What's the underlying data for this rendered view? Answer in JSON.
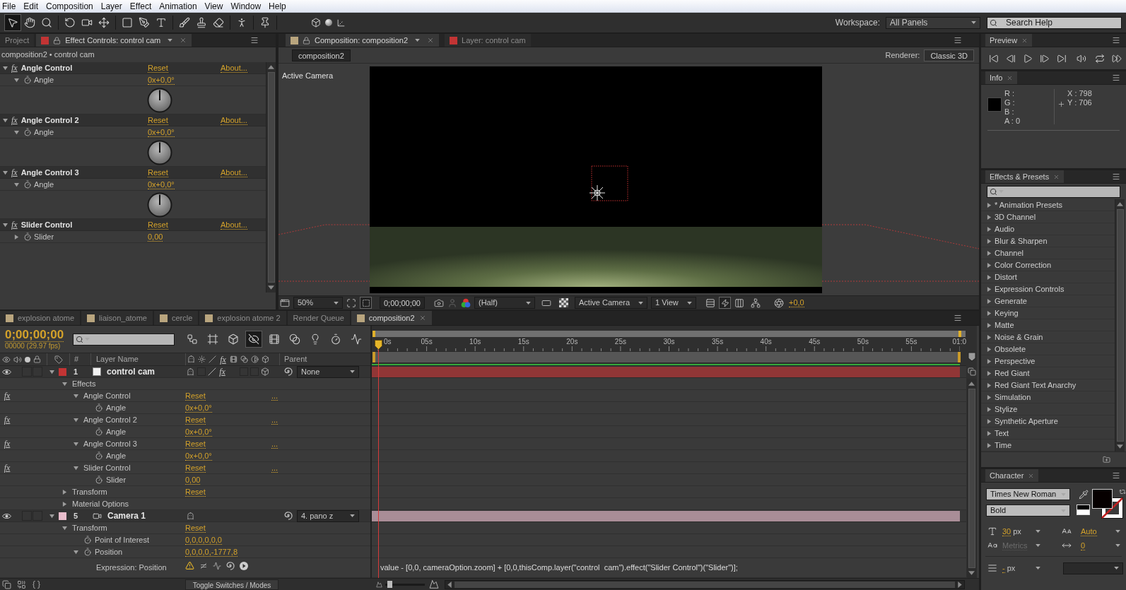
{
  "menu_bar": [
    "File",
    "Edit",
    "Composition",
    "Layer",
    "Effect",
    "Animation",
    "View",
    "Window",
    "Help"
  ],
  "toolbar": {
    "tools": [
      {
        "selected": true
      },
      {
        "selected": false
      },
      {
        "selected": false
      },
      {
        "selected": false
      },
      {
        "selected": false
      },
      {
        "selected": false
      },
      {
        "selected": false
      },
      {
        "selected": false
      },
      {
        "selected": false
      },
      {
        "selected": false
      },
      {
        "selected": false
      },
      {
        "selected": false
      },
      {
        "selected": false
      },
      {
        "selected": false
      }
    ],
    "workspace_label": "Workspace:",
    "workspace": "All Panels",
    "search": {
      "placeholder": "Search Help"
    }
  },
  "effect_controls": {
    "tabs": [
      {
        "label": "Project",
        "selected": false
      },
      {
        "label": "Effect Controls: control cam",
        "selected": true,
        "color": "#c23434"
      }
    ],
    "breadcrumb": "composition2 • control cam",
    "effects": [
      {
        "fx": "fx",
        "enabled": true,
        "name": "Angle Control",
        "expanded": true,
        "reset": "Reset",
        "about": "About...",
        "param": {
          "kind": "angle",
          "name": "Angle",
          "value": "0x+0,0°",
          "expanded": true
        }
      },
      {
        "fx": "fx",
        "enabled": true,
        "name": "Angle Control 2",
        "expanded": true,
        "reset": "Reset",
        "about": "About...",
        "param": {
          "kind": "angle",
          "name": "Angle",
          "value": "0x+0,0°",
          "expanded": true
        }
      },
      {
        "fx": "fx",
        "enabled": true,
        "name": "Angle Control 3",
        "expanded": true,
        "reset": "Reset",
        "about": "About...",
        "param": {
          "kind": "angle",
          "name": "Angle",
          "value": "0x+0,0°",
          "expanded": true
        }
      },
      {
        "fx": "fx",
        "enabled": true,
        "name": "Slider Control",
        "expanded": true,
        "reset": "Reset",
        "about": "About...",
        "param": {
          "name": "Slider",
          "value": "0,00",
          "expanded": false
        }
      }
    ]
  },
  "composition_panel": {
    "tabs": [
      {
        "label": "Composition: composition2",
        "selected": true,
        "color": "#b9a57e"
      },
      {
        "label": "Layer: control cam",
        "selected": false,
        "color": "#c23434"
      }
    ],
    "comp_button": "composition2",
    "renderer_label": "Renderer:",
    "renderer": "Classic 3D",
    "view_label": "Active Camera",
    "footer": {
      "zoom": "50%",
      "timecode": "0;00;00;00",
      "resolution": "(Half)",
      "camera": "Active Camera",
      "views": "1 View",
      "exposure": "+0,0"
    }
  },
  "preview": {
    "title": "Preview"
  },
  "info": {
    "title": "Info",
    "channels": [
      "R :",
      "G :",
      "B :",
      "A : 0"
    ],
    "position": [
      "X : 798",
      "Y : 706"
    ]
  },
  "effects_presets": {
    "title": "Effects & Presets",
    "categories": [
      {
        "name": "* Animation Presets",
        "expanded": false
      },
      {
        "name": "3D Channel",
        "expanded": false
      },
      {
        "name": "Audio",
        "expanded": false
      },
      {
        "name": "Blur & Sharpen",
        "expanded": false
      },
      {
        "name": "Channel",
        "expanded": false
      },
      {
        "name": "Color Correction",
        "expanded": false
      },
      {
        "name": "Distort",
        "expanded": false
      },
      {
        "name": "Expression Controls",
        "expanded": false
      },
      {
        "name": "Generate",
        "expanded": false
      },
      {
        "name": "Keying",
        "expanded": false
      },
      {
        "name": "Matte",
        "expanded": false
      },
      {
        "name": "Noise & Grain",
        "expanded": false
      },
      {
        "name": "Obsolete",
        "expanded": false
      },
      {
        "name": "Perspective",
        "expanded": false
      },
      {
        "name": "Red Giant",
        "expanded": false
      },
      {
        "name": "Red Giant Text Anarchy",
        "expanded": false
      },
      {
        "name": "Simulation",
        "expanded": false
      },
      {
        "name": "Stylize",
        "expanded": false
      },
      {
        "name": "Synthetic Aperture",
        "expanded": false
      },
      {
        "name": "Text",
        "expanded": false
      },
      {
        "name": "Time",
        "expanded": false
      }
    ]
  },
  "timeline": {
    "tabs": [
      {
        "label": "explosion atome",
        "selected": false,
        "color": "#b9a57e"
      },
      {
        "label": "liaison_atome",
        "selected": false,
        "color": "#b9a57e"
      },
      {
        "label": "cercle",
        "selected": false,
        "color": "#b9a57e"
      },
      {
        "label": "explosion atome 2",
        "selected": false,
        "color": "#b9a57e"
      },
      {
        "label": "Render Queue",
        "selected": false
      },
      {
        "label": "composition2",
        "selected": true,
        "color": "#b9a57e"
      }
    ],
    "timecode": "0;00;00;00",
    "frame_info": "00000 (29.97 fps)",
    "switches": [
      {
        "selected": false
      },
      {
        "selected": false
      },
      {
        "selected": false
      },
      {
        "selected": true
      },
      {
        "selected": false
      },
      {
        "selected": false
      },
      {
        "selected": false
      },
      {
        "selected": false
      },
      {
        "selected": false
      }
    ],
    "columns": {
      "number": "#",
      "layer_name": "Layer Name",
      "fx": "fx",
      "parent": "Parent"
    },
    "ruler": [
      "0s",
      "05s",
      "10s",
      "15s",
      "20s",
      "25s",
      "30s",
      "35s",
      "40s",
      "45s",
      "50s",
      "55s",
      "01:0"
    ],
    "layers": [
      {
        "number": "1",
        "name": "control cam",
        "kind": "solid",
        "color": "#c23434",
        "visible": true,
        "solo": false,
        "locked": false,
        "expanded": true,
        "fx_switch": {
          "label": "fx",
          "on": true
        },
        "parent": "None",
        "children": [
          {
            "kind": "group",
            "name": "Effects",
            "expanded": true,
            "children": [
              {
                "kind": "effect",
                "fx": "fx",
                "enabled": true,
                "name": "Angle Control",
                "expanded": true,
                "reset": "Reset",
                "more": "...",
                "children": [
                  {
                    "kind": "property",
                    "name": "Angle",
                    "value": "0x+0,0°"
                  }
                ]
              },
              {
                "kind": "effect",
                "fx": "fx",
                "enabled": true,
                "name": "Angle Control 2",
                "expanded": true,
                "reset": "Reset",
                "more": "...",
                "children": [
                  {
                    "kind": "property",
                    "name": "Angle",
                    "value": "0x+0,0°"
                  }
                ]
              },
              {
                "kind": "effect",
                "fx": "fx",
                "enabled": true,
                "name": "Angle Control 3",
                "expanded": true,
                "reset": "Reset",
                "more": "...",
                "children": [
                  {
                    "kind": "property",
                    "name": "Angle",
                    "value": "0x+0,0°"
                  }
                ]
              },
              {
                "kind": "effect",
                "fx": "fx",
                "enabled": true,
                "name": "Slider Control",
                "expanded": true,
                "reset": "Reset",
                "more": "...",
                "children": [
                  {
                    "kind": "property",
                    "name": "Slider",
                    "value": "0,00"
                  }
                ]
              }
            ]
          },
          {
            "kind": "group",
            "name": "Transform",
            "expanded": false,
            "reset": "Reset"
          },
          {
            "kind": "group",
            "name": "Material Options",
            "expanded": false
          }
        ]
      },
      {
        "number": "5",
        "name": "Camera 1",
        "kind": "camera",
        "color": "#e8bccb",
        "visible": true,
        "solo": false,
        "locked": false,
        "expanded": true,
        "parent": "4. pano z",
        "children": [
          {
            "kind": "group",
            "name": "Transform",
            "expanded": true,
            "reset": "Reset",
            "children": [
              {
                "kind": "property",
                "name": "Point of Interest",
                "value": "0,0,0,0,0,0"
              },
              {
                "kind": "property",
                "name": "Position",
                "value": "0,0,0,0,-1777,8",
                "expanded": true,
                "children": [
                  {
                    "kind": "expression",
                    "name": "Expression: Position",
                    "code": "value - [0,0, cameraOption.zoom] + [0,0,thisComp.layer(\"control  cam\").effect(\"Slider Control\")(\"Slider\")];"
                  }
                ]
              }
            ]
          }
        ]
      }
    ],
    "toggle_button": "Toggle Switches / Modes",
    "zoom_slider": {
      "level": 0.1
    }
  },
  "character": {
    "title": "Character",
    "font": "Times New Roman",
    "style": "Bold",
    "size": "30",
    "size_unit": "px",
    "leading": "Auto",
    "kerning": {
      "value": "Metrics",
      "disabled": true
    },
    "tracking": "0",
    "stroke_width": "-",
    "stroke_unit": "px"
  }
}
